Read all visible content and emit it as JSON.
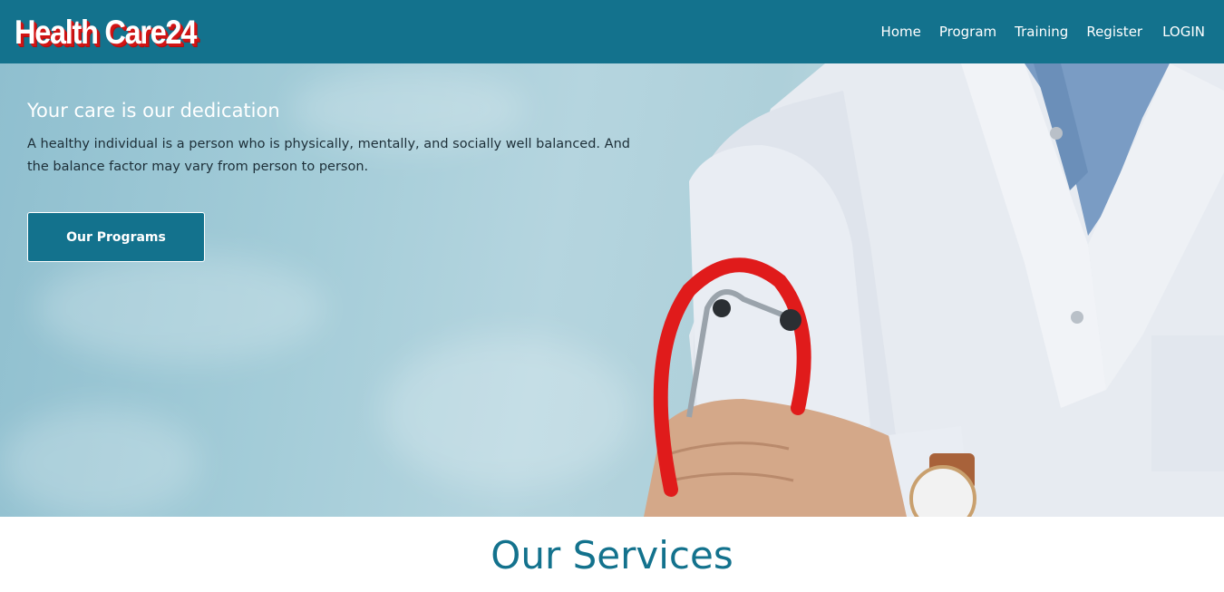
{
  "brand": {
    "name": "Health Care24"
  },
  "nav": {
    "items": [
      {
        "label": "Home"
      },
      {
        "label": "Program"
      },
      {
        "label": "Training"
      },
      {
        "label": "Register"
      },
      {
        "label": "LOGIN"
      }
    ]
  },
  "hero": {
    "title": "Your care is our dedication",
    "text": "A healthy individual is a person who is physically, mentally, and socially well balanced. And the balance factor may vary from person to person.",
    "button_label": "Our Programs"
  },
  "services": {
    "title": "Our Services"
  },
  "colors": {
    "primary": "#13728d",
    "brand_shadow": "#d21414",
    "hero_bg": "#a3ccd8"
  }
}
